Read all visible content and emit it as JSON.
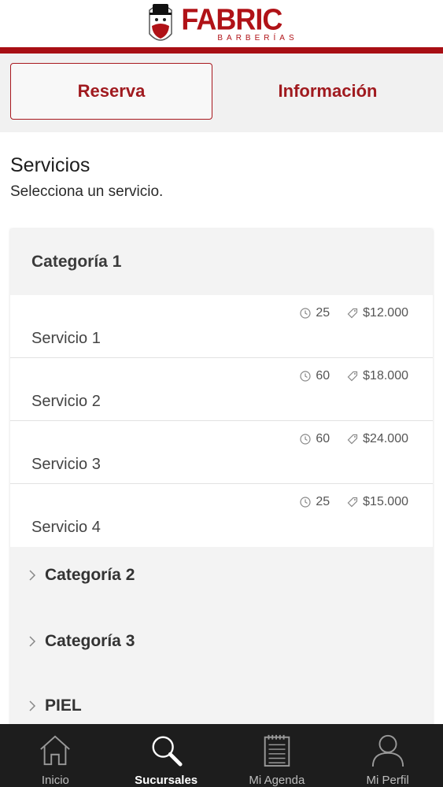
{
  "brand": {
    "name": "FABRIC",
    "subtitle": "BARBERÍAS",
    "color": "#b01217"
  },
  "tabs": [
    {
      "label": "Reserva",
      "active": true
    },
    {
      "label": "Información",
      "active": false
    }
  ],
  "section": {
    "title": "Servicios",
    "subtitle": "Selecciona un servicio."
  },
  "categories": {
    "open": {
      "label": "Categoría 1",
      "services": [
        {
          "name": "Servicio 1",
          "duration": "25",
          "price": "$12.000"
        },
        {
          "name": "Servicio 2",
          "duration": "60",
          "price": "$18.000"
        },
        {
          "name": "Servicio 3",
          "duration": "60",
          "price": "$24.000"
        },
        {
          "name": "Servicio 4",
          "duration": "25",
          "price": "$15.000"
        }
      ]
    },
    "collapsed": [
      {
        "label": "Categoría 2"
      },
      {
        "label": "Categoría 3"
      },
      {
        "label": "PIEL"
      }
    ]
  },
  "nav": [
    {
      "label": "Inicio",
      "icon": "home-icon",
      "active": false
    },
    {
      "label": "Sucursales",
      "icon": "search-icon",
      "active": true
    },
    {
      "label": "Mi Agenda",
      "icon": "agenda-icon",
      "active": false
    },
    {
      "label": "Mi Perfil",
      "icon": "user-icon",
      "active": false
    }
  ]
}
